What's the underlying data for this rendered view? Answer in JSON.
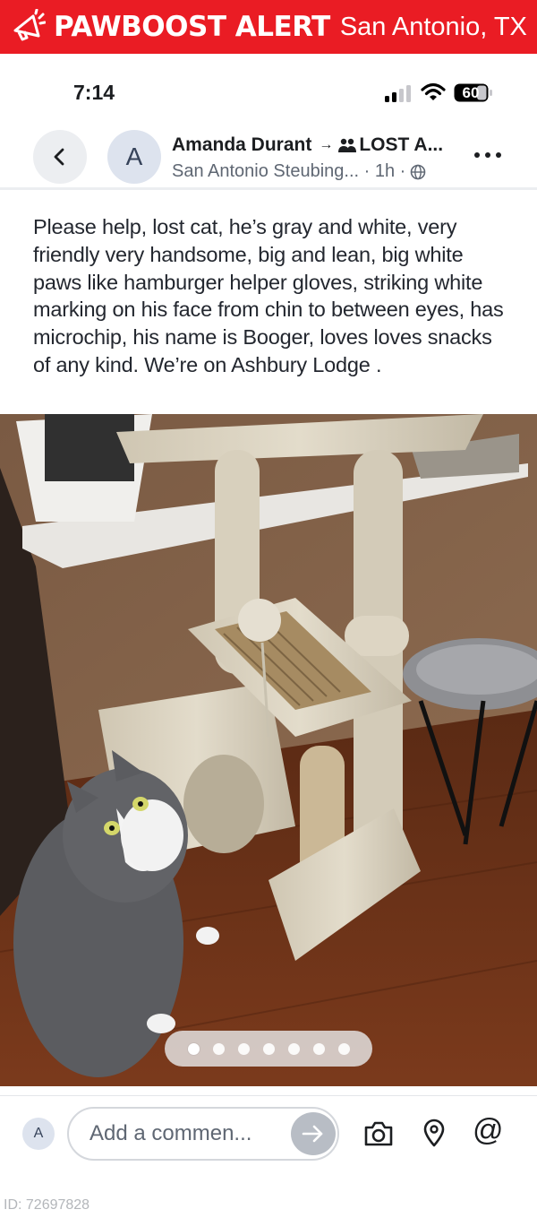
{
  "alert": {
    "brand": "PAWBOOST ALERT",
    "city": "San Antonio, TX",
    "color": "#ea1c24"
  },
  "status_bar": {
    "time": "7:14",
    "battery": "60"
  },
  "post": {
    "avatar_initial": "A",
    "author": "Amanda Durant",
    "arrow": "→",
    "group": "LOST A...",
    "meta": "San Antonio Steubing... · 1h ·",
    "body": "Please help, lost cat, he’s gray and white, very friendly very handsome, big and lean, big white paws like hamburger helper gloves, striking white marking on his face from chin to between eyes, has microchip, his name is Booger, loves loves snacks of any kind. We’re on Ashbury Lodge ."
  },
  "photo": {
    "carousel_total": 7,
    "carousel_active": 1
  },
  "comment": {
    "avatar_initial": "A",
    "placeholder": "Add a commen..."
  },
  "footer": {
    "id_label": "ID: 72697828"
  },
  "icons": [
    "megaphone-icon",
    "signal-icon",
    "wifi-icon",
    "battery-icon",
    "back-icon",
    "group-icon",
    "globe-icon",
    "more-icon",
    "send-icon",
    "camera-icon",
    "location-pin-icon",
    "at-icon"
  ]
}
